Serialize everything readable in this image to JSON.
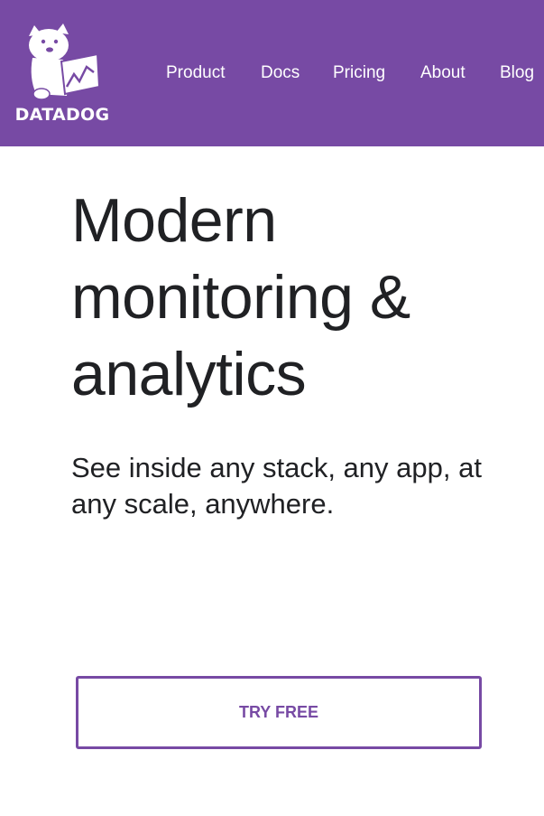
{
  "brand": {
    "name": "DATADOG",
    "icon": "datadog-dog-logo-icon",
    "header_color": "#774aa4"
  },
  "nav": {
    "items": [
      {
        "label": "Product"
      },
      {
        "label": "Docs"
      },
      {
        "label": "Pricing"
      },
      {
        "label": "About"
      },
      {
        "label": "Blog"
      }
    ]
  },
  "hero": {
    "title": "Modern monitoring & analytics",
    "subtitle": "See inside any stack, any app, at any scale, anywhere.",
    "cta_label": "TRY FREE",
    "accent_color": "#774aa4"
  }
}
